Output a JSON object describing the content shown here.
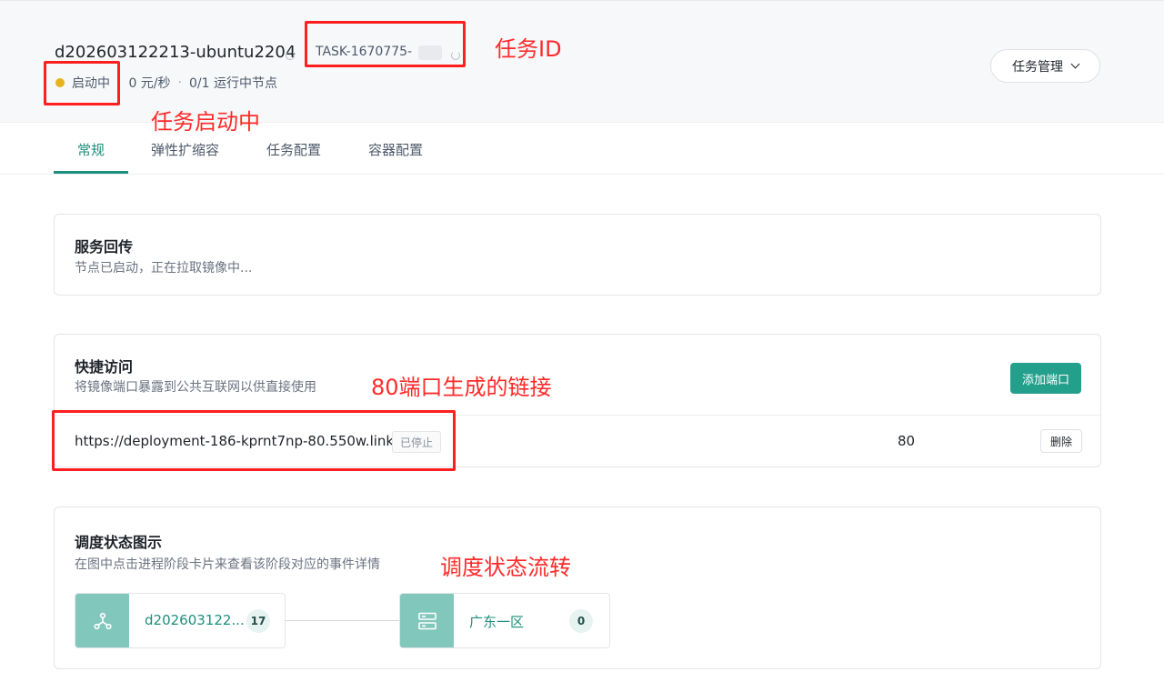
{
  "header": {
    "task_name": "d202603122213-ubuntu2204",
    "task_id": "TASK-1670775-",
    "status": "启动中",
    "price": "0 元/秒",
    "nodes": "0/1 运行中节点",
    "separator": "·",
    "manage_button": "任务管理"
  },
  "annotations": {
    "task_id": "任务ID",
    "starting": "任务启动中",
    "port_link": "80端口生成的链接",
    "flow": "调度状态流转"
  },
  "tabs": [
    "常规",
    "弹性扩缩容",
    "任务配置",
    "容器配置"
  ],
  "service": {
    "title": "服务回传",
    "subtitle": "节点已启动，正在拉取镜像中..."
  },
  "quick_access": {
    "title": "快捷访问",
    "subtitle": "将镜像端口暴露到公共互联网以供直接使用",
    "add_button": "添加端口",
    "link": "https://deployment-186-kprnt7np-80.550w.link",
    "link_status": "已停止",
    "port": "80",
    "delete_button": "删除"
  },
  "schedule": {
    "title": "调度状态图示",
    "subtitle": "在图中点击进程阶段卡片来查看该阶段对应的事件详情",
    "nodes": [
      {
        "label": "d202603122...",
        "count": "17",
        "icon": "cluster-icon"
      },
      {
        "label": "广东一区",
        "count": "0",
        "icon": "server-icon"
      }
    ]
  },
  "colors": {
    "accent": "#1c8f7d",
    "button": "#23a08c",
    "status_dot": "#e8b21c",
    "annotation": "#ff1f1f"
  }
}
